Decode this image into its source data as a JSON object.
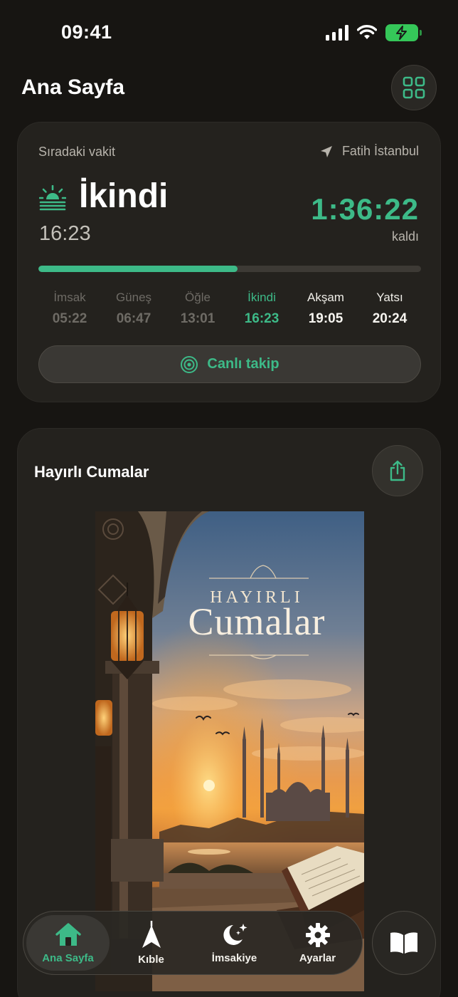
{
  "status_bar": {
    "time": "09:41"
  },
  "header": {
    "title": "Ana Sayfa"
  },
  "prayer_card": {
    "next_label": "Sıradaki vakit",
    "location": "Fatih İstanbul",
    "current_name": "İkindi",
    "current_time": "16:23",
    "countdown": "1:36:22",
    "remaining_label": "kaldı",
    "progress_percent": 52,
    "times": [
      {
        "name": "İmsak",
        "time": "05:22",
        "state": "past"
      },
      {
        "name": "Güneş",
        "time": "06:47",
        "state": "past"
      },
      {
        "name": "Öğle",
        "time": "13:01",
        "state": "past"
      },
      {
        "name": "İkindi",
        "time": "16:23",
        "state": "current"
      },
      {
        "name": "Akşam",
        "time": "19:05",
        "state": "upcoming"
      },
      {
        "name": "Yatsı",
        "time": "20:24",
        "state": "upcoming"
      }
    ],
    "live_button_label": "Canlı takip"
  },
  "friday_card": {
    "title": "Hayırlı Cumalar",
    "poster_line1": "HAYIRLI",
    "poster_line2": "Cumalar"
  },
  "tab_bar": {
    "tabs": [
      {
        "label": "Ana Sayfa",
        "icon": "home-icon",
        "active": true
      },
      {
        "label": "Kıble",
        "icon": "compass-arrow-icon",
        "active": false
      },
      {
        "label": "İmsakiye",
        "icon": "crescent-moon-icon",
        "active": false
      },
      {
        "label": "Ayarlar",
        "icon": "gear-icon",
        "active": false
      }
    ]
  },
  "colors": {
    "accent": "#3dba88",
    "background": "#171512",
    "card": "#24221e"
  }
}
